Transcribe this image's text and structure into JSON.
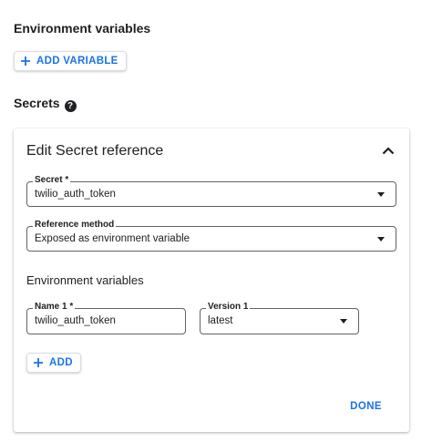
{
  "env_section": {
    "title": "Environment variables",
    "add_variable_label": "ADD VARIABLE"
  },
  "secrets_section": {
    "title": "Secrets",
    "help_glyph": "?"
  },
  "card": {
    "title": "Edit Secret reference",
    "secret_field": {
      "label": "Secret *",
      "value": "twilio_auth_token"
    },
    "reference_method_field": {
      "label": "Reference method",
      "value": "Exposed as environment variable"
    },
    "env_vars_heading": "Environment variables",
    "name_field": {
      "label": "Name 1 *",
      "value": "twilio_auth_token"
    },
    "version_field": {
      "label": "Version 1",
      "value": "latest"
    },
    "add_label": "ADD",
    "done_label": "DONE"
  },
  "colors": {
    "accent": "#1a73e8",
    "text": "#202124",
    "border": "#5f6368"
  }
}
